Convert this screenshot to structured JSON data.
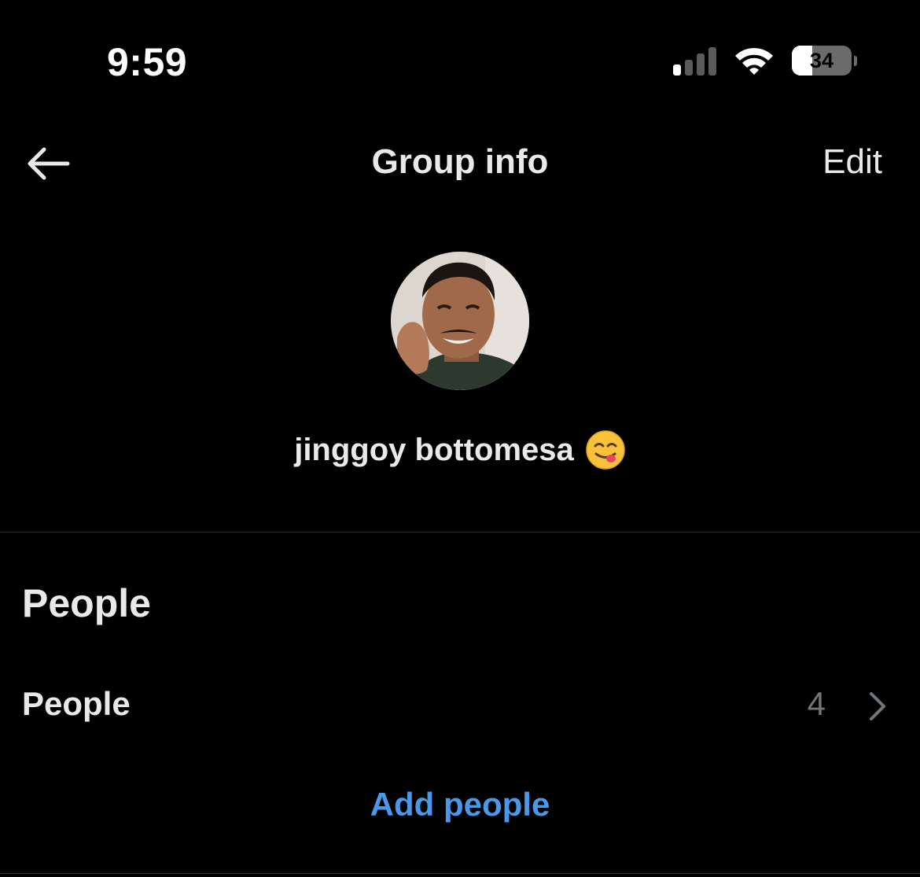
{
  "status_bar": {
    "time": "9:59",
    "battery_level": "34",
    "battery_fraction": 0.34
  },
  "header": {
    "title": "Group info",
    "edit_label": "Edit",
    "back_icon": "arrow-left-icon"
  },
  "group": {
    "name": "jinggoy bottomesa",
    "emoji": "face-savoring-food-emoji"
  },
  "people_section": {
    "title": "People",
    "row_label": "People",
    "count": "4",
    "add_label": "Add people"
  },
  "colors": {
    "background": "#000000",
    "text": "#e7e9ea",
    "muted": "#71767b",
    "accent": "#4a99e9",
    "divider": "#2f3336"
  }
}
